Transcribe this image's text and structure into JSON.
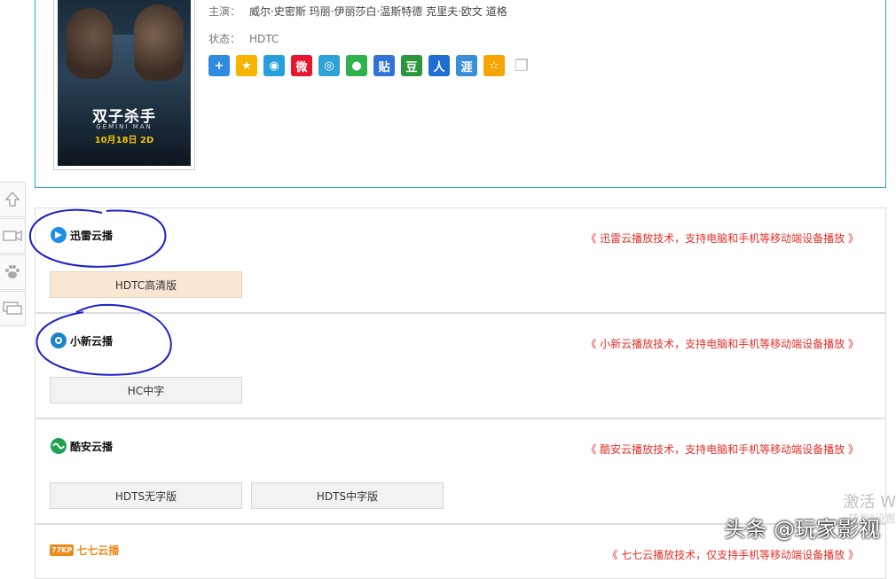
{
  "info": {
    "actors_label": "主演：",
    "actors": "威尔·史密斯   玛丽·伊丽莎白·温斯特德   克里夫·欧文   道格",
    "status_label": "状态：",
    "status": "HDTC",
    "poster": {
      "title": "双子杀手",
      "subtitle": "GEMINI MAN",
      "date": "10月18日 2D"
    }
  },
  "share_icons": [
    {
      "name": "plus-share-icon",
      "glyph": "+",
      "color": "#2e8be0"
    },
    {
      "name": "qzone-icon",
      "glyph": "★",
      "color": "#f5b400"
    },
    {
      "name": "qq-icon",
      "glyph": "◉",
      "color": "#26a0da"
    },
    {
      "name": "weibo-icon",
      "glyph": "微",
      "color": "#e6162d"
    },
    {
      "name": "tencent-weibo-icon",
      "glyph": "◎",
      "color": "#2fa2d6"
    },
    {
      "name": "wechat-icon",
      "glyph": "●",
      "color": "#2fb24c"
    },
    {
      "name": "tieba-icon",
      "glyph": "贴",
      "color": "#3072d8"
    },
    {
      "name": "douban-icon",
      "glyph": "豆",
      "color": "#2d963d"
    },
    {
      "name": "renren-icon",
      "glyph": "人",
      "color": "#1f6ed3"
    },
    {
      "name": "kaixin-icon",
      "glyph": "涯",
      "color": "#3a8fd6"
    },
    {
      "name": "favorite-star-icon",
      "glyph": "☆",
      "color": "#f6a400"
    },
    {
      "name": "copy-icon",
      "glyph": "❐",
      "color": "#cccccc"
    }
  ],
  "sources": [
    {
      "name": "迅雷云播",
      "desc": "《 迅雷云播放技术，支持电脑和手机等移动端设备播放 》",
      "episodes": [
        "HDTC高清版"
      ],
      "logo_color": "#1d8ee8"
    },
    {
      "name": "小新云播",
      "desc": "《 小新云播放技术，支持电脑和手机等移动端设备播放 》",
      "episodes": [
        "HC中字"
      ],
      "logo_color": "#1a84c9"
    },
    {
      "name": "酷安云播",
      "desc": "《 酷安云播放技术，支持电脑和手机等移动端设备播放 》",
      "episodes": [
        "HDTS无字版",
        "HDTS中字版"
      ],
      "logo_color": "#1fa152"
    },
    {
      "name": "七七云播",
      "desc": "《 七七云播放技术，仅支持手机等移动端设备播放 》",
      "episodes": [],
      "logo_color": "#f08a1a",
      "logo_prefix": "77KP"
    }
  ],
  "sidebar": [
    "back-to-top-icon",
    "video-icon",
    "paw-icon",
    "comment-icon"
  ],
  "overlay": {
    "activate": "激活 W",
    "activate_sub": "转到\"设置",
    "watermark": "头条 @玩家影视"
  }
}
